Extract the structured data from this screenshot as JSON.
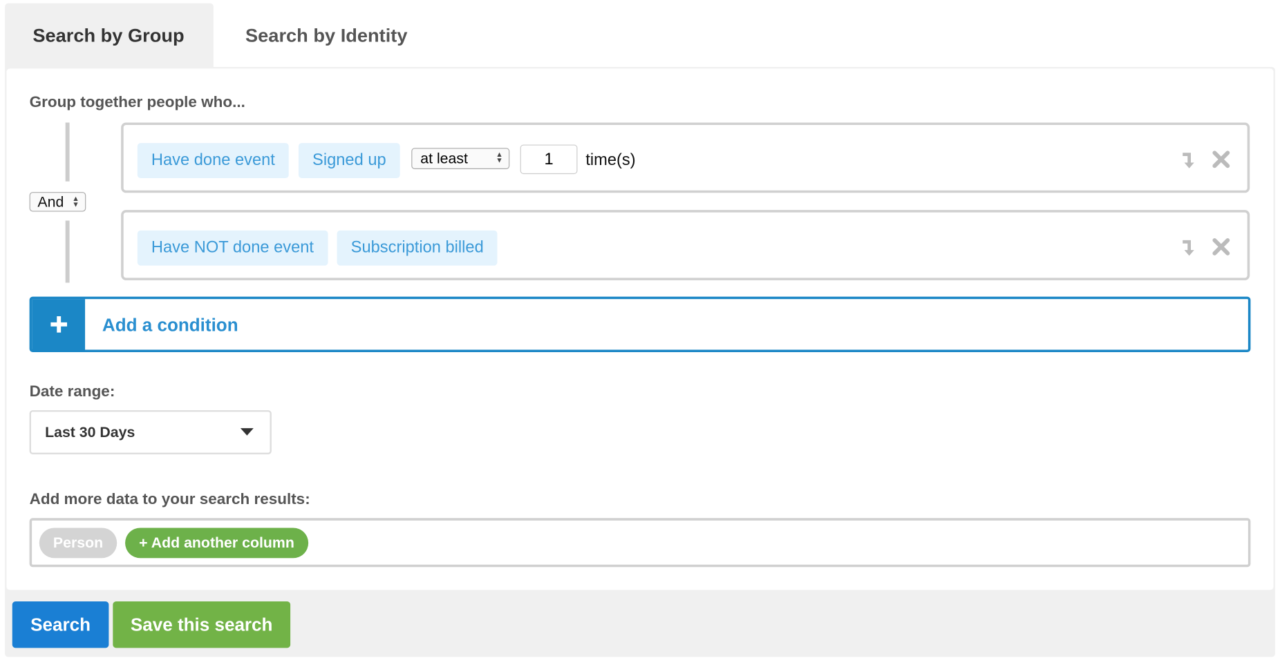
{
  "tabs": [
    {
      "label": "Search by Group",
      "active": true
    },
    {
      "label": "Search by Identity",
      "active": false
    }
  ],
  "group_label": "Group together people who...",
  "combinator": "And",
  "conditions": [
    {
      "type": "Have done event",
      "event": "Signed up",
      "comparator": "at least",
      "count": "1",
      "unit": "time(s)"
    },
    {
      "type": "Have NOT done event",
      "event": "Subscription billed"
    }
  ],
  "icons": {
    "move": "arrow-down-corner-icon",
    "remove": "close-x-icon",
    "add": "plus-icon",
    "dropdown": "caret-down-icon"
  },
  "add_condition": "Add a condition",
  "date_range": {
    "label": "Date range:",
    "value": "Last 30 Days"
  },
  "columns": {
    "label": "Add more data to your search results:",
    "items": [
      "Person"
    ],
    "add_label": "+ Add another column"
  },
  "actions": {
    "search": "Search",
    "save": "Save this search"
  },
  "colors": {
    "accent_blue": "#1b87c6",
    "search_button": "#1a7fd4",
    "green": "#72b347",
    "tag_bg": "#e4f3fd",
    "tag_text": "#3b9ad8"
  }
}
